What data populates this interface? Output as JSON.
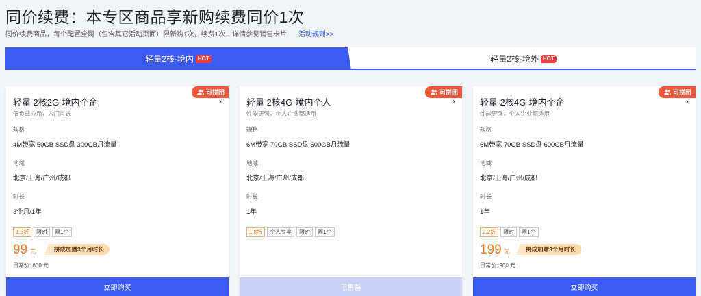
{
  "header": {
    "title": "同价续费：本专区商品享新购续费同价1次",
    "subtitle": "同价续费商品，每个配置全网（包含其它活动页面）限新购1次，续费1次，详情参见销售卡片",
    "rules_link": "活动规则>>"
  },
  "tabs": [
    {
      "label": "轻量2核-境内",
      "badge": "HOT",
      "active": true
    },
    {
      "label": "轻量2核-境外",
      "badge": "HOT",
      "active": false
    }
  ],
  "cards": [
    {
      "badge": "可拼团",
      "title": "轻量 2核2G-境内个企",
      "desc": "低负载应用，入门首选",
      "spec_label": "规格",
      "spec": "4M带宽 50GB SSD盘 300GB月流量",
      "region_label": "地域",
      "region": "北京/上海/广州/成都",
      "duration_label": "时长",
      "duration": "3个月/1年",
      "tags": [
        "1.6折",
        "限时",
        "限1个"
      ],
      "price": "99",
      "price_unit": "元",
      "promo": "拼成加赠3个月时长",
      "original": "日常价: 600 元",
      "button": "立即购买"
    },
    {
      "badge": "可拼团",
      "title": "轻量 2核4G-境内个人",
      "desc": "性能更强，个人企业都适用",
      "spec_label": "规格",
      "spec": "6M带宽 70GB SSD盘 600GB月流量",
      "region_label": "地域",
      "region": "北京/上海/广州/成都",
      "duration_label": "时长",
      "duration": "1年",
      "tags": [
        "1.8折",
        "个人专享",
        "限时",
        "限1个"
      ],
      "button": "已售罄"
    },
    {
      "badge": "可拼团",
      "title": "轻量 2核4G-境内个企",
      "desc": "性能更强，个人企业都适用",
      "spec_label": "规格",
      "spec": "6M带宽 70GB SSD盘 600GB月流量",
      "region_label": "地域",
      "region": "北京/上海/广州/成都",
      "duration_label": "时长",
      "duration": "1年",
      "tags": [
        "2.2折",
        "限时",
        "限1个"
      ],
      "price": "199",
      "price_unit": "元",
      "promo": "拼成加赠3个月时长",
      "original": "日常价: 900 元",
      "button": "立即购买"
    }
  ],
  "colors": {
    "accent": "#3d5af5",
    "price": "#f07a1f",
    "hot": "#f03c3c",
    "badge": "#f0573a",
    "soldout": "#c8d3f5"
  }
}
